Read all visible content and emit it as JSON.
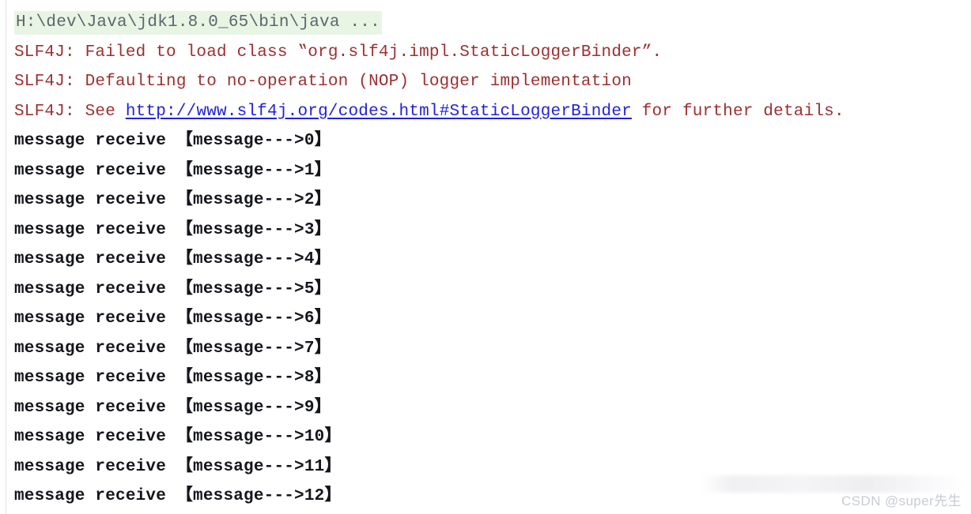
{
  "console": {
    "command_line": {
      "text": "H:\\dev\\Java\\jdk1.8.0_65\\bin\\java ...",
      "highlight_color": "#e8f5e4",
      "text_color": "#5c666e"
    },
    "slf4j_lines": [
      {
        "prefix": "SLF4J: Failed to load class ‟org.slf4j.impl.StaticLoggerBinder”.",
        "link": "",
        "suffix": ""
      },
      {
        "prefix": "SLF4J: Defaulting to no-operation (NOP) logger implementation",
        "link": "",
        "suffix": ""
      },
      {
        "prefix": "SLF4J: See ",
        "link": "http://www.slf4j.org/codes.html#StaticLoggerBinder",
        "suffix": " for further details."
      }
    ],
    "slf4j_color": "#9e2f2f",
    "link_color": "#2121e0",
    "message_lines": [
      "message receive 【message--->0】",
      "message receive 【message--->1】",
      "message receive 【message--->2】",
      "message receive 【message--->3】",
      "message receive 【message--->4】",
      "message receive 【message--->5】",
      "message receive 【message--->6】",
      "message receive 【message--->7】",
      "message receive 【message--->8】",
      "message receive 【message--->9】",
      "message receive 【message--->10】",
      "message receive 【message--->11】",
      "message receive 【message--->12】"
    ],
    "message_color": "#14161c"
  },
  "watermark": {
    "text": "CSDN @super先生",
    "color": "#c8ccd2"
  }
}
